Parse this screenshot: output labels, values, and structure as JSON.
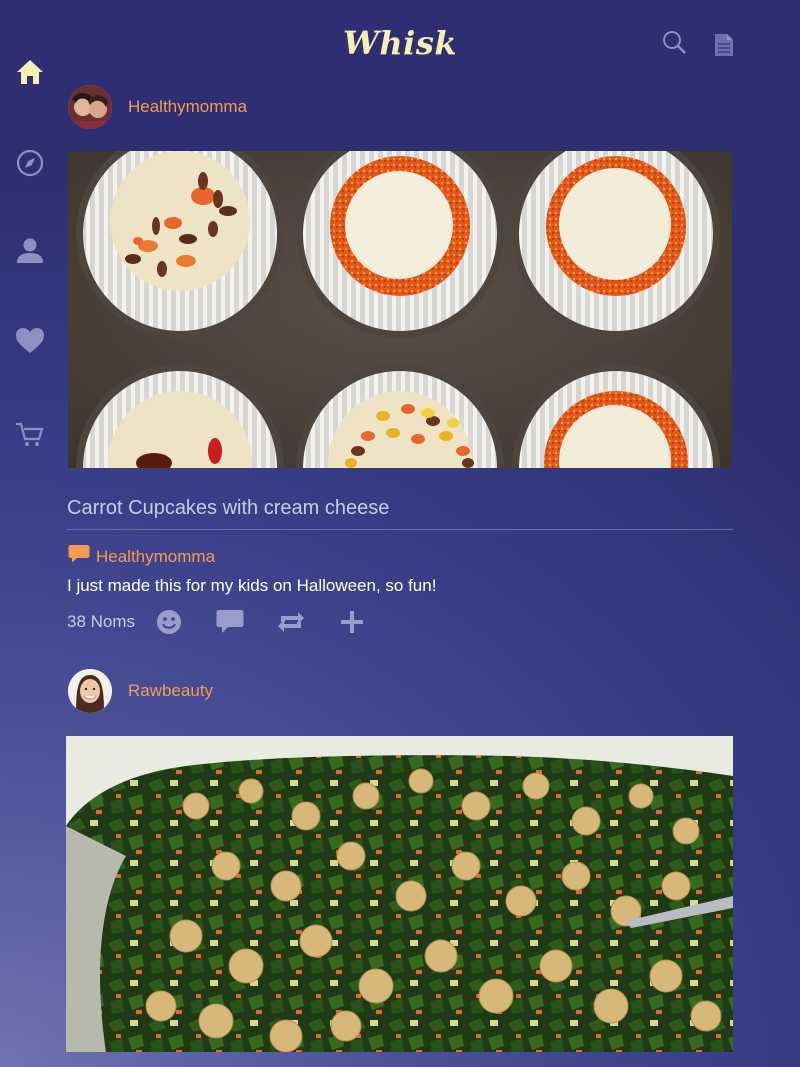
{
  "app": {
    "logo": "Whisk"
  },
  "header": {
    "icons": [
      "search-icon",
      "document-icon"
    ]
  },
  "sidebar": {
    "items": [
      {
        "name": "home",
        "icon": "home-icon",
        "active": true
      },
      {
        "name": "explore",
        "icon": "compass-icon"
      },
      {
        "name": "profile",
        "icon": "user-icon"
      },
      {
        "name": "favorites",
        "icon": "heart-icon"
      },
      {
        "name": "cart",
        "icon": "cart-icon"
      }
    ]
  },
  "colors": {
    "accent": "#f59a52",
    "logo": "#f6efb4",
    "active_icon": "#f6efb4",
    "muted": "#c8cbe6"
  },
  "feed": {
    "post1": {
      "username": "Healthymomma",
      "photo": "cupcakes-photo",
      "title": "Carrot Cupcakes with cream cheese",
      "comment_author": "Healthymomma",
      "comment_text": "I just made this for my kids on Halloween, so fun!",
      "noms": "38 Noms",
      "actions": [
        "smile-icon",
        "comment-icon",
        "repost-icon",
        "add-icon"
      ]
    },
    "post2": {
      "username": "Rawbeauty",
      "photo": "chickpea-salad-photo"
    }
  }
}
